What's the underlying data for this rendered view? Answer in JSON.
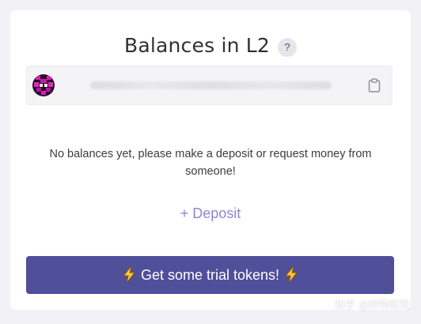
{
  "panel": {
    "title": "Balances in L2",
    "help_label": "?"
  },
  "account": {
    "address": "0x0000000000000000000000000000000000000000",
    "avatar_icon": "identicon",
    "copy_icon": "clipboard-icon"
  },
  "empty_state": {
    "message": "No balances yet, please make a deposit or request money from someone!"
  },
  "actions": {
    "deposit_label": "+ Deposit",
    "trial_label": "Get some trial tokens!",
    "trial_icon": "lightning-icon"
  },
  "watermark": {
    "text": "知乎 @好物新知"
  },
  "colors": {
    "background": "#f1f1f6",
    "card": "#ffffff",
    "accent": "#4f4f9a",
    "deposit_link": "#8d87ce"
  }
}
